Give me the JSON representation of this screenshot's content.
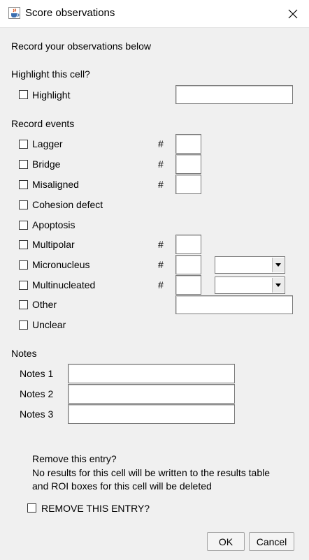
{
  "window": {
    "title": "Score observations",
    "close_icon": "close-icon",
    "app_icon": "java-cup-icon"
  },
  "intro": "Record your observations below",
  "highlight_section": {
    "heading": "Highlight this cell?",
    "checkbox_label": "Highlight",
    "checked": false,
    "text_value": ""
  },
  "events_section": {
    "heading": "Record events",
    "items": [
      {
        "label": "Lagger",
        "checked": false,
        "count_label": "#",
        "count": ""
      },
      {
        "label": "Bridge",
        "checked": false,
        "count_label": "#",
        "count": ""
      },
      {
        "label": "Misaligned",
        "checked": false,
        "count_label": "#",
        "count": ""
      },
      {
        "label": "Cohesion defect",
        "checked": false
      },
      {
        "label": "Apoptosis",
        "checked": false
      },
      {
        "label": "Multipolar",
        "checked": false,
        "count_label": "#",
        "count": ""
      },
      {
        "label": "Micronucleus",
        "checked": false,
        "count_label": "#",
        "count": "",
        "select_value": ""
      },
      {
        "label": "Multinucleated",
        "checked": false,
        "count_label": "#",
        "count": "",
        "select_value": ""
      },
      {
        "label": "Other",
        "checked": false,
        "text_value": ""
      },
      {
        "label": "Unclear",
        "checked": false
      }
    ]
  },
  "notes_section": {
    "heading": "Notes",
    "fields": [
      {
        "label": "Notes 1",
        "value": ""
      },
      {
        "label": "Notes 2",
        "value": ""
      },
      {
        "label": "Notes 3",
        "value": ""
      }
    ]
  },
  "remove_section": {
    "line1": "Remove this entry?",
    "line2": "No results for this cell will be written to the results table",
    "line3": "and ROI boxes for this cell will be deleted",
    "checkbox_label": "REMOVE THIS ENTRY?",
    "checked": false
  },
  "buttons": {
    "ok": "OK",
    "cancel": "Cancel"
  }
}
